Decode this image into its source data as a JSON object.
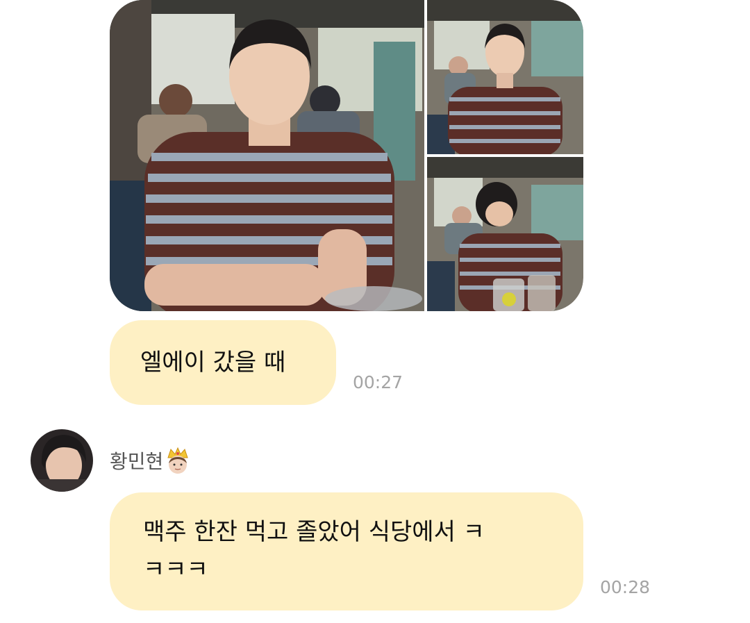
{
  "messages": [
    {
      "sender": "me",
      "text": "엘에이 갔을 때",
      "time": "00:27"
    },
    {
      "sender": "황민현",
      "text": "맥주 한잔 먹고 졸았어 식당에서 ㅋ\nㅋㅋㅋ",
      "time": "00:28"
    }
  ],
  "sender": {
    "name": "황민현",
    "emoji_icon": "prince-crown-icon"
  },
  "photos": [
    "photo-restaurant-main",
    "photo-restaurant-sleeping",
    "photo-restaurant-looking-down"
  ],
  "colors": {
    "bubble": "#fef0c4",
    "time_text": "#a4a4a4",
    "name_text": "#555555"
  }
}
